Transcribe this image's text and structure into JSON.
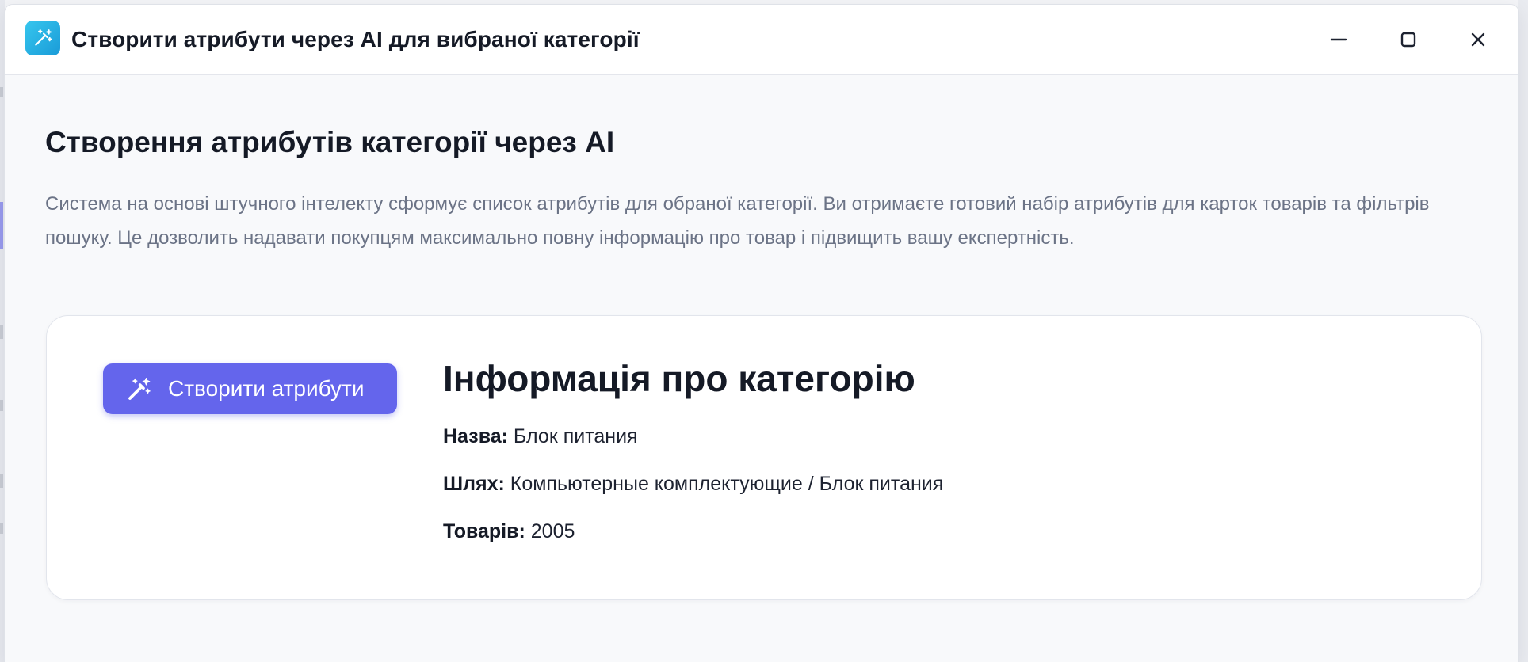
{
  "window": {
    "title": "Створити атрибути через AI для вибраної категорії",
    "icon": "magic-wand-icon",
    "controls": {
      "minimize": "minimize-icon",
      "maximize": "maximize-icon",
      "close": "close-icon"
    }
  },
  "content": {
    "title": "Створення атрибутів категорії через AI",
    "description": "Система на основі штучного інтелекту сформує список атрибутів для обраної категорії. Ви отримаєте готовий набір атрибутів для карток товарів та фільтрів пошуку. Це дозволить надавати покупцям максимально повну інформацію про товар і підвищить вашу експертність."
  },
  "card": {
    "create_button_label": "Створити атрибути",
    "create_button_icon": "sparkle-wand-icon",
    "heading": "Інформація про категорію",
    "name_label": "Назва:",
    "name_value": "Блок питания",
    "path_label": "Шлях:",
    "path_value": "Компьютерные комплектующие / Блок питания",
    "count_label": "Товарів:",
    "count_value": "2005"
  },
  "colors": {
    "accent": "#6465ec",
    "app_icon": "#1a9bd8",
    "text_primary": "#151a26",
    "text_secondary": "#6b7386",
    "window_bg": "#f8f9fb"
  }
}
